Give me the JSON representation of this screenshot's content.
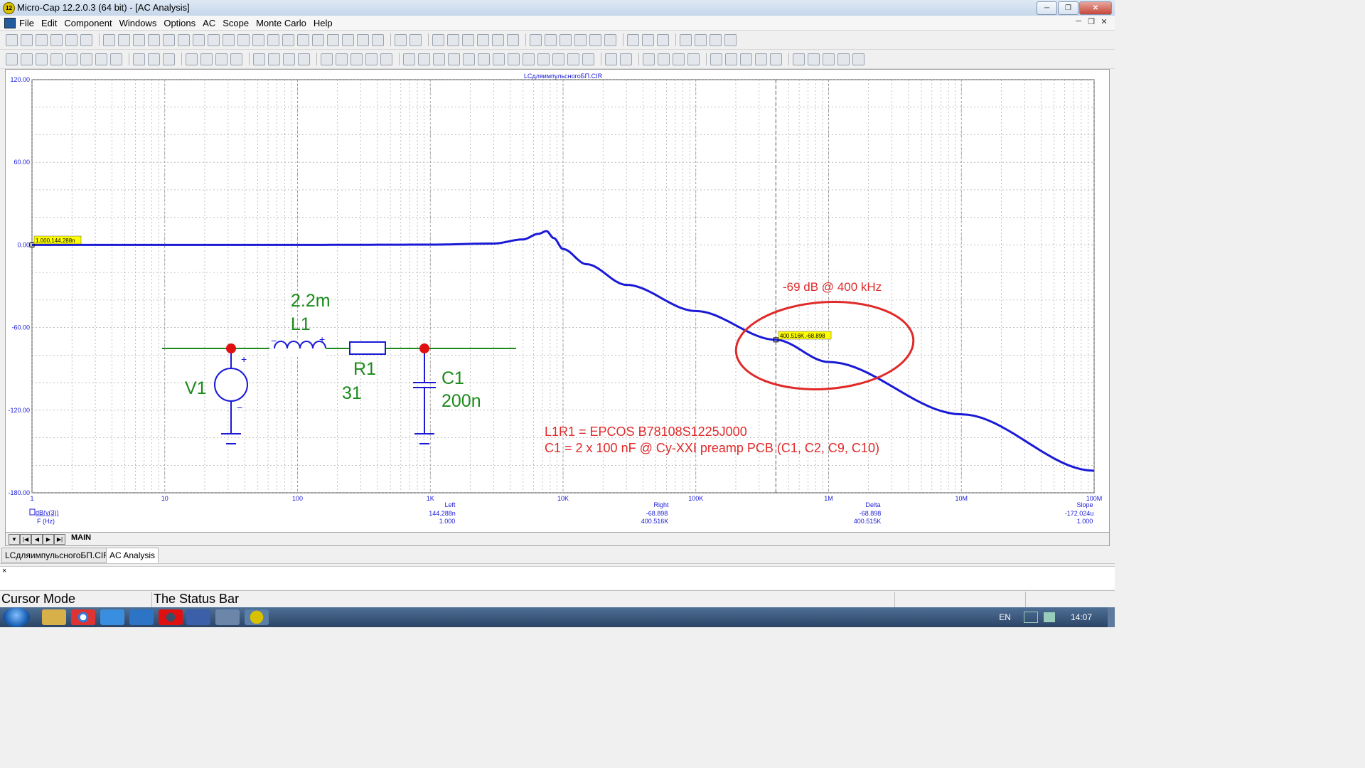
{
  "window": {
    "title": "Micro-Cap 12.2.0.3 (64 bit) - [AC Analysis]",
    "app_icon_label": "12"
  },
  "menu": {
    "items": [
      "File",
      "Edit",
      "Component",
      "Windows",
      "Options",
      "AC",
      "Scope",
      "Monte Carlo",
      "Help"
    ]
  },
  "plot": {
    "file_title": "LCдляимпульсногоБП.CIR",
    "y_ticks": [
      "120.00",
      "60.00",
      "0.00",
      "-60.00",
      "-120.00",
      "-180.00"
    ],
    "x_ticks": [
      "1",
      "10",
      "100",
      "1K",
      "10K",
      "100K",
      "1M",
      "10M",
      "100M"
    ],
    "y_trace_label": "dB(v(3))",
    "x_axis_label": "F (Hz)",
    "cursor_left_tag": "1.000,144.288n",
    "cursor_right_tag": "400.516K,-68.898",
    "readout": {
      "left": {
        "title": "Left",
        "y": "144.288n",
        "x": "1.000"
      },
      "right": {
        "title": "Right",
        "y": "-68.898",
        "x": "400.516K"
      },
      "delta": {
        "title": "Delta",
        "y": "-68.898",
        "x": "400.515K"
      },
      "slope": {
        "title": "Slope",
        "y": "-172.024u",
        "x": "1.000"
      }
    },
    "schematic": {
      "l1_value": "2.2m",
      "l1_name": "L1",
      "r1_name": "R1",
      "r1_value": "31",
      "c1_name": "C1",
      "c1_value": "200n",
      "v1_name": "V1"
    },
    "annotations": {
      "callout": "-69 dB @ 400 kHz",
      "note_line1": "L1R1 = EPCOS B78108S1225J000",
      "note_line2": "C1 = 2 x 100 nF @ Cy-XXI preamp PCB  (C1, C2, C9, C10)"
    },
    "colors": {
      "trace": "#1a1ad6",
      "schematic": "#1a8a1a",
      "node": "#e01010",
      "annotation": "#e02a2a",
      "cursor_tag": "#ffff00"
    }
  },
  "tabs": {
    "page_tab": "MAIN",
    "doc_tab_1": "LCдляимпульсногоБП.CIR",
    "doc_tab_2": "AC Analysis"
  },
  "output": {
    "close_mark": "×"
  },
  "status": {
    "mode": "Cursor Mode",
    "text": "The Status Bar"
  },
  "taskbar": {
    "lang": "EN",
    "clock": "14:07"
  },
  "chart_data": {
    "type": "line",
    "x_scale": "log",
    "xlim": [
      1,
      100000000
    ],
    "ylim": [
      -180,
      120
    ],
    "xlabel": "F (Hz)",
    "ylabel": "dB(v(3))",
    "grid": true,
    "series": [
      {
        "name": "dB(v(3))",
        "x": [
          1,
          10,
          100,
          1000,
          3000,
          5000,
          6500,
          7500,
          8500,
          10000,
          15000,
          30000,
          100000,
          400516,
          1000000,
          10000000,
          100000000
        ],
        "y": [
          0,
          0,
          0,
          0.2,
          1,
          4,
          8,
          10,
          5,
          -3,
          -14,
          -29,
          -48,
          -68.9,
          -85,
          -123,
          -164
        ]
      }
    ],
    "cursors": [
      {
        "x": 1,
        "y": 1.44288e-07
      },
      {
        "x": 400516,
        "y": -68.898
      }
    ]
  }
}
